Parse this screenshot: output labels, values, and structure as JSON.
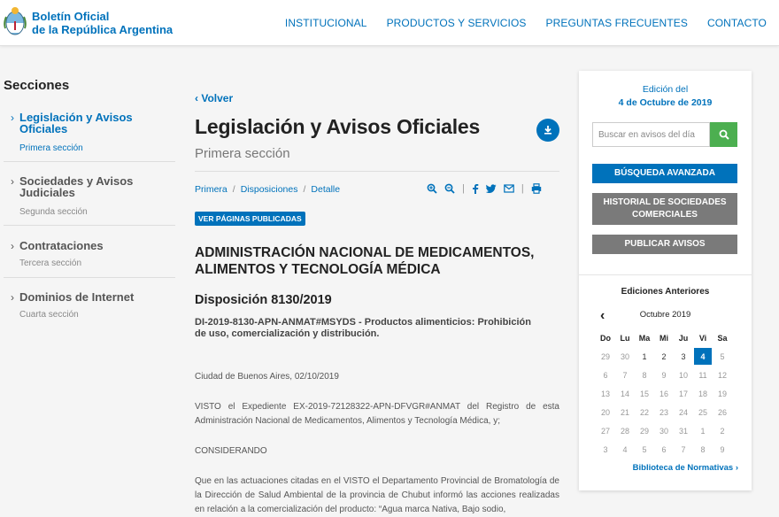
{
  "header": {
    "brand_line1": "Boletín Oficial",
    "brand_line2": "de la República Argentina",
    "nav": [
      "INSTITUCIONAL",
      "PRODUCTOS Y SERVICIOS",
      "PREGUNTAS FRECUENTES",
      "CONTACTO"
    ]
  },
  "sidebar": {
    "title": "Secciones",
    "items": [
      {
        "title_l1": "Legislación y Avisos",
        "title_l2": "Oficiales",
        "sub": "Primera sección"
      },
      {
        "title_l1": "Sociedades y Avisos",
        "title_l2": "Judiciales",
        "sub": "Segunda sección"
      },
      {
        "title_l1": "Contrataciones",
        "title_l2": "",
        "sub": "Tercera sección"
      },
      {
        "title_l1": "Dominios de Internet",
        "title_l2": "",
        "sub": "Cuarta sección"
      }
    ]
  },
  "main": {
    "back": "Volver",
    "title": "Legislación y Avisos Oficiales",
    "subtitle": "Primera sección",
    "breadcrumb": [
      "Primera",
      "Disposiciones",
      "Detalle"
    ],
    "ver_paginas": "VER PÁGINAS PUBLICADAS",
    "org_l1": "ADMINISTRACIÓN NACIONAL DE MEDICAMENTOS,",
    "org_l2": "ALIMENTOS Y TECNOLOGÍA MÉDICA",
    "disposition": "Disposición 8130/2019",
    "summary_l1": "DI-2019-8130-APN-ANMAT#MSYDS - Productos alimenticios: Prohibición",
    "summary_l2": "de uso, comercialización y distribución.",
    "p1": "Ciudad de Buenos Aires, 02/10/2019",
    "p2": "VISTO el Expediente EX-2019-72128322-APN-DFVGR#ANMAT del Registro de esta Administración Nacional de Medicamentos, Alimentos y Tecnología Médica, y;",
    "p3": "CONSIDERANDO",
    "p4": "Que en las actuaciones citadas en el VISTO el Departamento Provincial de Bromatología de la Dirección de Salud Ambiental de la provincia de Chubut informó las acciones realizadas en relación a la comercialización del producto: “Agua marca Nativa, Bajo sodio,"
  },
  "panel": {
    "edition_label": "Edición del",
    "edition_date": "4 de Octubre de 2019",
    "search_placeholder": "Buscar en avisos del día",
    "btn_advanced": "BÚSQUEDA AVANZADA",
    "btn_history_l1": "HISTORIAL DE SOCIEDADES",
    "btn_history_l2": "COMERCIALES",
    "btn_publish": "PUBLICAR AVISOS",
    "prev_editions": "Ediciones Anteriores",
    "month": "Octubre 2019",
    "weekdays": [
      "Do",
      "Lu",
      "Ma",
      "Mi",
      "Ju",
      "Vi",
      "Sa"
    ],
    "days": [
      [
        "29",
        "30",
        "1",
        "2",
        "3",
        "4",
        "5"
      ],
      [
        "6",
        "7",
        "8",
        "9",
        "10",
        "11",
        "12"
      ],
      [
        "13",
        "14",
        "15",
        "16",
        "17",
        "18",
        "19"
      ],
      [
        "20",
        "21",
        "22",
        "23",
        "24",
        "25",
        "26"
      ],
      [
        "27",
        "28",
        "29",
        "30",
        "31",
        "1",
        "2"
      ],
      [
        "3",
        "4",
        "5",
        "6",
        "7",
        "8",
        "9"
      ]
    ],
    "selected_day": "4",
    "biblioteca": "Biblioteca de Normativas"
  },
  "colors": {
    "accent": "#0072bb",
    "search_green": "#4caf50",
    "grey_button": "#7a7a7a"
  }
}
